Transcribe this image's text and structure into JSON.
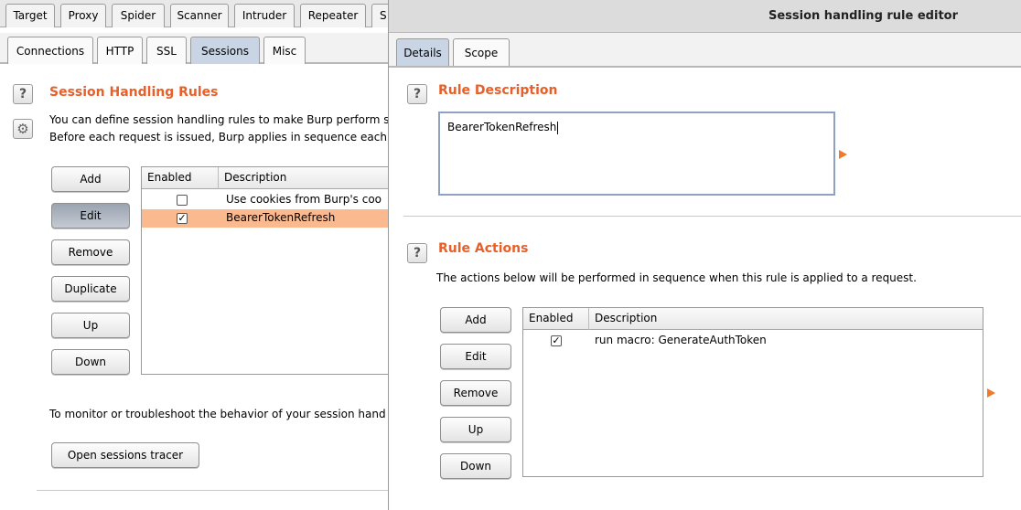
{
  "main": {
    "top_tabs": [
      "Target",
      "Proxy",
      "Spider",
      "Scanner",
      "Intruder",
      "Repeater",
      "S"
    ],
    "sub_tabs": [
      "Connections",
      "HTTP",
      "SSL",
      "Sessions",
      "Misc"
    ],
    "active_sub_tab": "Sessions",
    "section_title": "Session Handling Rules",
    "intro_line_1": "You can define session handling rules to make Burp perform s",
    "intro_line_2": "Before each request is issued, Burp applies in sequence each",
    "buttons": {
      "add": "Add",
      "edit": "Edit",
      "remove": "Remove",
      "duplicate": "Duplicate",
      "up": "Up",
      "down": "Down"
    },
    "table": {
      "headers": [
        "Enabled",
        "Description"
      ],
      "rows": [
        {
          "enabled": false,
          "description": "Use cookies from Burp's coo"
        },
        {
          "enabled": true,
          "description": "BearerTokenRefresh"
        }
      ]
    },
    "monitor_text": "To monitor or troubleshoot the behavior of your session hand",
    "tracer_button": "Open sessions tracer"
  },
  "dialog": {
    "title": "Session handling rule editor",
    "tabs": [
      "Details",
      "Scope"
    ],
    "active_tab": "Details",
    "rule_description": {
      "title": "Rule Description",
      "value": "BearerTokenRefresh"
    },
    "rule_actions": {
      "title": "Rule Actions",
      "intro": "The actions below will be performed in sequence when this rule is applied to a request.",
      "buttons": {
        "add": "Add",
        "edit": "Edit",
        "remove": "Remove",
        "up": "Up",
        "down": "Down"
      },
      "table": {
        "headers": [
          "Enabled",
          "Description"
        ],
        "rows": [
          {
            "enabled": true,
            "description": "run macro: GenerateAuthToken"
          }
        ]
      }
    }
  },
  "colors": {
    "accent": "#e85f2a",
    "selected_row": "#fbb98f",
    "active_tab": "#c9d4e4"
  },
  "icons": [
    "help-icon",
    "gear-icon",
    "expand-arrow-icon",
    "checkbox-checked-icon",
    "checkbox-unchecked-icon"
  ]
}
